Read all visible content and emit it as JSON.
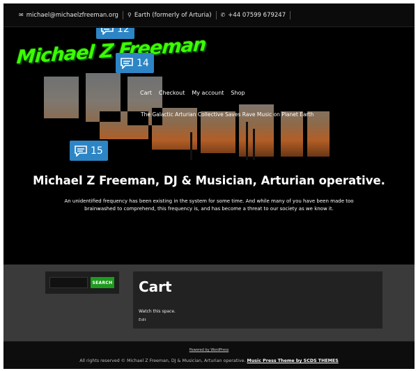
{
  "topbar": {
    "email": "michael@michaelzfreeman.org",
    "location": "Earth (formerly of Arturia)",
    "phone": "+44 07599 679247"
  },
  "logo": {
    "text": "Michael Z Freeman"
  },
  "nav": {
    "items": [
      "Cart",
      "Checkout",
      "My account",
      "Shop"
    ]
  },
  "tagline": "The Galactic Arturian Collective Saves Rave Music on Planet Earth",
  "comments": {
    "badge_a": "12",
    "badge_b": "14",
    "badge_c": "15"
  },
  "hero": {
    "headline": "Michael Z Freeman, DJ & Musician, Arturian operative.",
    "subtext": "An unidentified frequency has been existing in the system for some time. And while many of you have been made too brainwashed to comprehend, this frequency is, and has become a threat to our society as we know it."
  },
  "search": {
    "placeholder": "",
    "button_label": "SEARCH"
  },
  "page": {
    "title": "Cart",
    "body": "Watch this space.",
    "edit_label": "Edit"
  },
  "footer": {
    "powered": "Powered by WordPress",
    "rights": "All rights reserved © Michael Z Freeman, DJ & Musician, Arturian operative.",
    "theme_link": "Music Press Theme by SCDS THEMES"
  },
  "colors": {
    "accent_green": "#3cff00",
    "badge_blue": "#2d85c5",
    "search_green": "#1e9b1e"
  }
}
